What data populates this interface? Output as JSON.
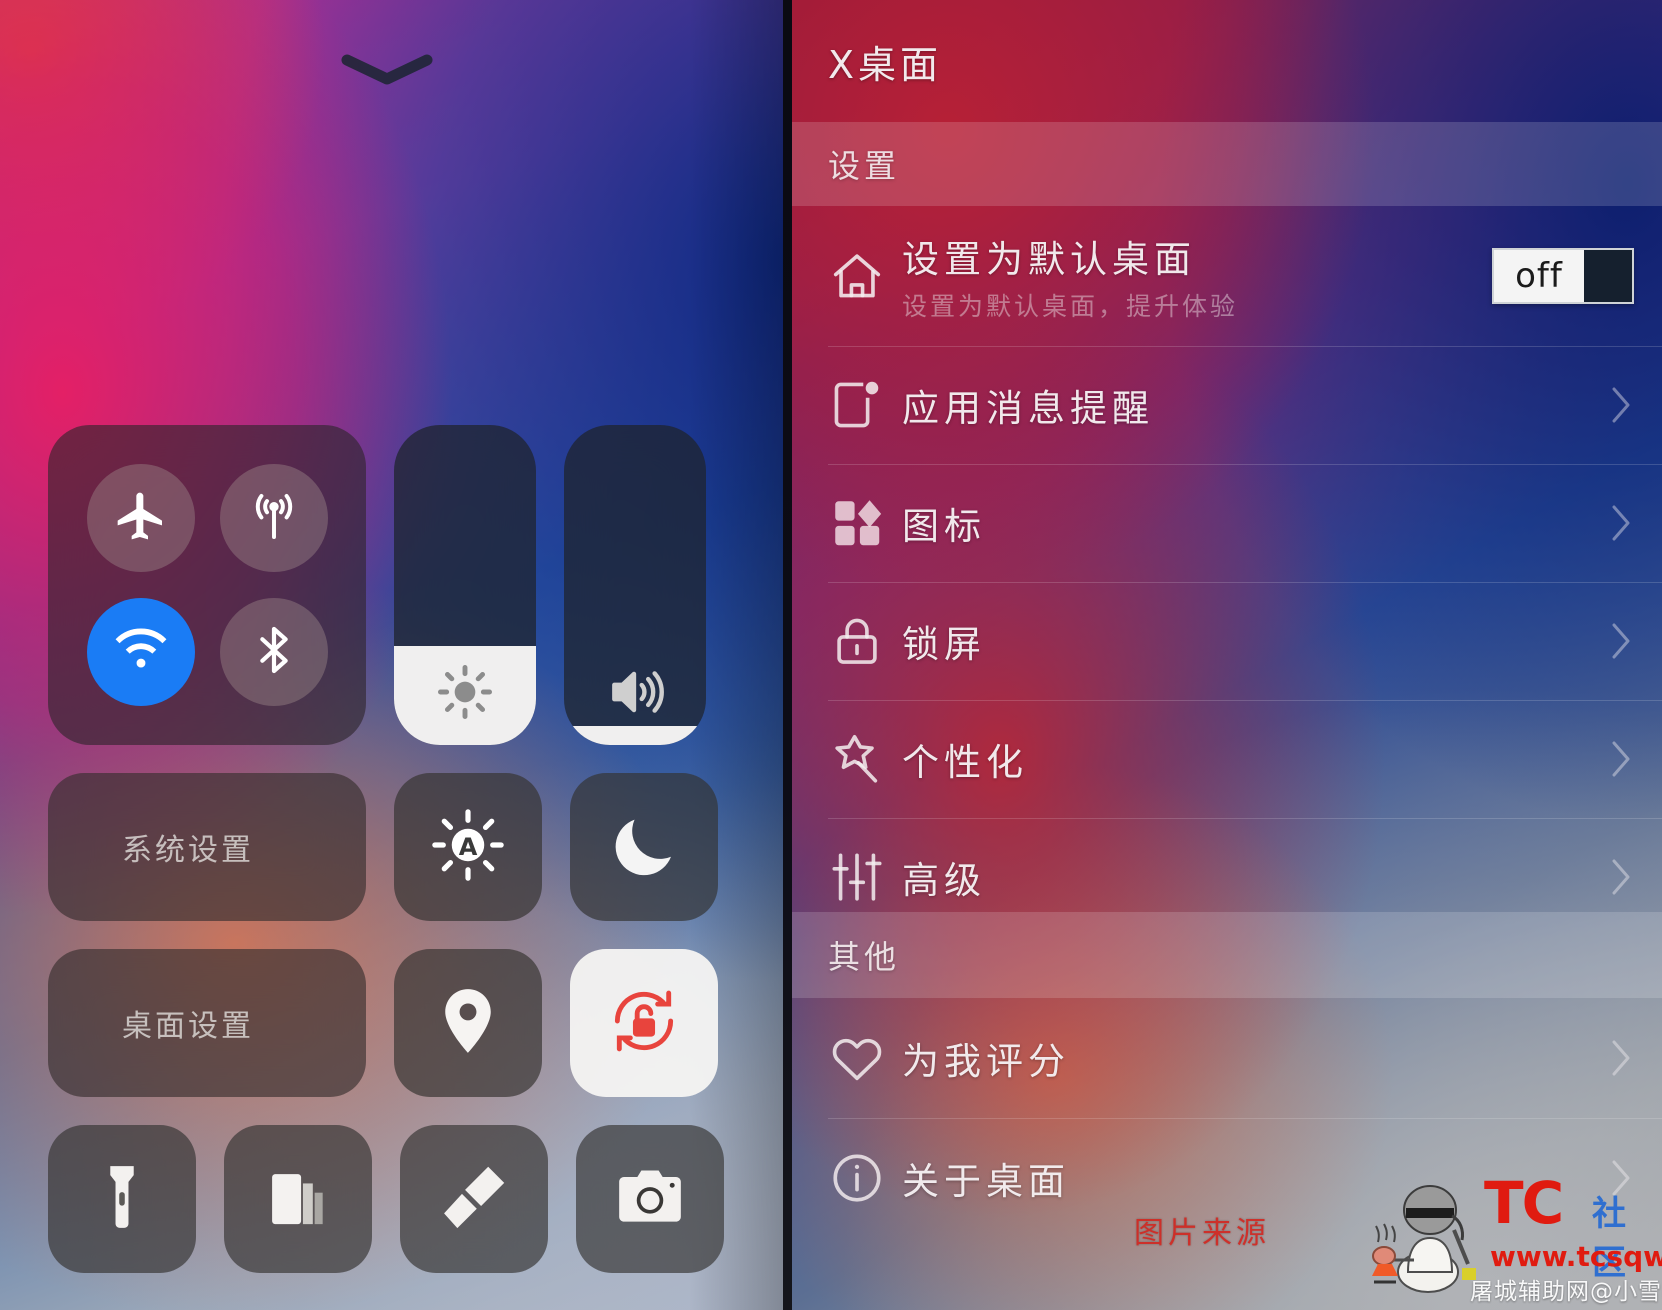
{
  "control_center": {
    "grabber_icon": "chevron-down-icon",
    "connectivity": [
      {
        "name": "airplane-mode",
        "icon": "airplane-icon",
        "active": false
      },
      {
        "name": "cellular-data",
        "icon": "cellular-antenna-icon",
        "active": false
      },
      {
        "name": "wifi",
        "icon": "wifi-icon",
        "active": true
      },
      {
        "name": "bluetooth",
        "icon": "bluetooth-icon",
        "active": false
      }
    ],
    "sliders": [
      {
        "name": "brightness",
        "icon": "brightness-sun-icon",
        "value_pct": 31
      },
      {
        "name": "volume",
        "icon": "speaker-volume-icon",
        "value_pct": 6
      }
    ],
    "tiles_row2": [
      {
        "name": "system-settings",
        "label": "系统设置",
        "icon": "gear-icon",
        "wide": true,
        "active": false
      },
      {
        "name": "auto-brightness",
        "label": "",
        "icon": "auto-brightness-icon",
        "wide": false,
        "active": false
      },
      {
        "name": "do-not-disturb",
        "label": "",
        "icon": "moon-icon",
        "wide": false,
        "active": false
      }
    ],
    "tiles_row3": [
      {
        "name": "desktop-settings",
        "label": "桌面设置",
        "icon": "toggle-switch-icon",
        "wide": true,
        "active": false
      },
      {
        "name": "location",
        "label": "",
        "icon": "location-pin-icon",
        "wide": false,
        "active": false
      },
      {
        "name": "rotation-lock",
        "label": "",
        "icon": "rotation-lock-icon",
        "wide": false,
        "active": true
      }
    ],
    "tiles_row4": [
      {
        "name": "flashlight",
        "icon": "flashlight-icon"
      },
      {
        "name": "calculator",
        "icon": "calculator-icon"
      },
      {
        "name": "wallpaper",
        "icon": "paint-roller-icon"
      },
      {
        "name": "camera",
        "icon": "camera-icon"
      }
    ]
  },
  "settings": {
    "title": "X桌面",
    "section_settings": "设置",
    "section_other": "其他",
    "toggle": {
      "label": "off",
      "state": "off"
    },
    "items": [
      {
        "name": "set-default-launcher",
        "label": "设置为默认桌面",
        "sub": "设置为默认桌面，提升体验",
        "icon": "home-icon",
        "control": "toggle"
      },
      {
        "name": "app-notifications",
        "label": "应用消息提醒",
        "sub": "",
        "icon": "notification-badge-icon",
        "control": "chevron"
      },
      {
        "name": "icons",
        "label": "图标",
        "sub": "",
        "icon": "grid-icon",
        "control": "chevron"
      },
      {
        "name": "lock-screen",
        "label": "锁屏",
        "sub": "",
        "icon": "lock-icon",
        "control": "chevron"
      },
      {
        "name": "personalization",
        "label": "个性化",
        "sub": "",
        "icon": "magic-star-icon",
        "control": "chevron"
      },
      {
        "name": "advanced",
        "label": "高级",
        "sub": "",
        "icon": "sliders-icon",
        "control": "chevron"
      }
    ],
    "other_items": [
      {
        "name": "rate-us",
        "label": "为我评分",
        "icon": "heart-icon",
        "control": "chevron"
      },
      {
        "name": "about",
        "label": "关于桌面",
        "icon": "info-icon",
        "control": "chevron"
      }
    ]
  },
  "watermark": {
    "source_label": "图片来源",
    "brand": "TC",
    "community": "社区",
    "url": "www.tcsqw.com",
    "site": "屠城辅助网@小雪曦曦"
  }
}
